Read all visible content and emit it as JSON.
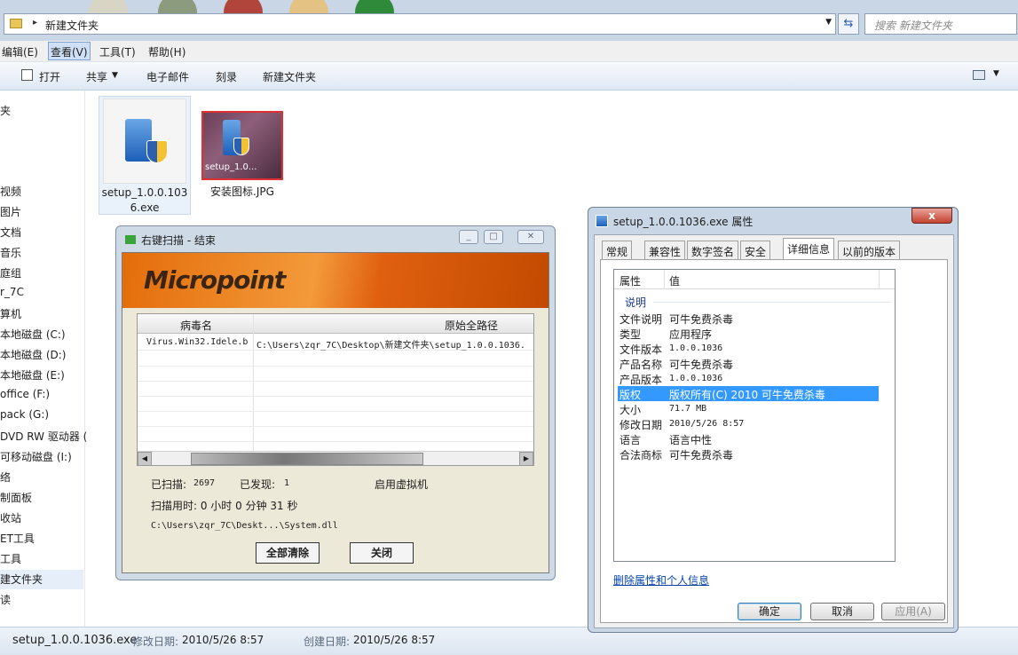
{
  "explorer": {
    "address_path": "新建文件夹",
    "search_placeholder": "搜索 新建文件夹",
    "menu": [
      "编辑(E)",
      "查看(V)",
      "工具(T)",
      "帮助(H)"
    ],
    "commands": [
      "打开",
      "共享",
      "电子邮件",
      "刻录",
      "新建文件夹"
    ],
    "nav_items": [
      "夹",
      "视频",
      "图片",
      "文档",
      "音乐",
      "庭组",
      "r_7C",
      "算机",
      "本地磁盘 (C:)",
      "本地磁盘 (D:)",
      "本地磁盘 (E:)",
      "office (F:)",
      "pack (G:)",
      "DVD RW 驱动器 (",
      "可移动磁盘 (I:)",
      "络",
      "制面板",
      "收站",
      "ET工具",
      "工具",
      "建文件夹",
      "读"
    ],
    "files": [
      {
        "name_line1": "setup_1.0.0.103",
        "name_line2": "6.exe"
      },
      {
        "thumb_caption": "setup_1.0...",
        "name": "安装图标.JPG"
      }
    ],
    "status": {
      "filename": "setup_1.0.0.1036.exe",
      "modified_label": "修改日期:",
      "modified_value": "2010/5/26 8:57",
      "created_label": "创建日期:",
      "created_value": "2010/5/26 8:57"
    }
  },
  "scan_window": {
    "title": "右键扫描 - 结束",
    "logo": "Micropoint",
    "columns": [
      "病毒名",
      "原始全路径"
    ],
    "rows": [
      {
        "virus": "Virus.Win32.Idele.b",
        "path": "C:\\Users\\zqr_7C\\Desktop\\新建文件夹\\setup_1.0.0.1036."
      }
    ],
    "scanned_label": "已扫描:",
    "scanned_value": "2697",
    "found_label": "已发现:",
    "found_value": "1",
    "vm_label": "启用虚拟机",
    "time_text": "扫描用时: 0 小时 0 分钟 31 秒",
    "current_file": "C:\\Users\\zqr_7C\\Deskt...\\System.dll",
    "btn_clear": "全部清除",
    "btn_close": "关闭"
  },
  "prop_window": {
    "title": "setup_1.0.0.1036.exe 属性",
    "close": "x",
    "tabs": [
      "常规",
      "兼容性",
      "数字签名",
      "安全",
      "详细信息",
      "以前的版本"
    ],
    "active_tab": "详细信息",
    "col_prop": "属性",
    "col_value": "值",
    "group": "说明",
    "rows": [
      {
        "k": "文件说明",
        "v": "可牛免费杀毒"
      },
      {
        "k": "类型",
        "v": "应用程序"
      },
      {
        "k": "文件版本",
        "v": "1.0.0.1036"
      },
      {
        "k": "产品名称",
        "v": "可牛免费杀毒"
      },
      {
        "k": "产品版本",
        "v": "1.0.0.1036"
      },
      {
        "k": "版权",
        "v": "版权所有(C) 2010 可牛免费杀毒"
      },
      {
        "k": "大小",
        "v": "71.7 MB"
      },
      {
        "k": "修改日期",
        "v": "2010/5/26 8:57"
      },
      {
        "k": "语言",
        "v": "语言中性"
      },
      {
        "k": "合法商标",
        "v": "可牛免费杀毒"
      }
    ],
    "link": "删除属性和个人信息",
    "btn_ok": "确定",
    "btn_cancel": "取消",
    "btn_apply": "应用(A)"
  }
}
